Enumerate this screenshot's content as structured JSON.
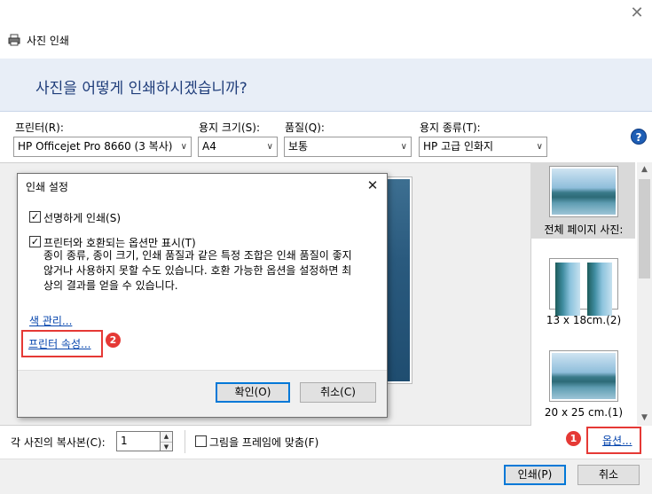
{
  "window": {
    "title": "사진 인쇄",
    "close_glyph": "✕"
  },
  "banner": {
    "heading": "사진을 어떻게 인쇄하시겠습니까?"
  },
  "selectors": {
    "printer": {
      "label": "프린터(R):",
      "value": "HP Officejet Pro 8660 (3 복사)"
    },
    "paper_size": {
      "label": "용지 크기(S):",
      "value": "A4"
    },
    "quality": {
      "label": "품질(Q):",
      "value": "보통"
    },
    "paper_type": {
      "label": "용지 종류(T):",
      "value": "HP 고급 인화지"
    }
  },
  "help_glyph": "?",
  "layouts": [
    {
      "label": "전체 페이지 사진:",
      "selected": true
    },
    {
      "label": "13 x 18cm.(2)",
      "selected": false
    },
    {
      "label": "20 x 25 cm.(1)",
      "selected": false
    }
  ],
  "dialog": {
    "title": "인쇄 설정",
    "close_glyph": "✕",
    "sharpen": {
      "label": "선명하게 인쇄(S)",
      "checked": true
    },
    "compatible": {
      "label": "프린터와 호환되는 옵션만 표시(T)",
      "checked": true,
      "description_lines": [
        "종이 종류, 종이 크기, 인쇄 품질과 같은 특정 조합은 인쇄 품질이 좋지",
        "않거나 사용하지 못할 수도 있습니다. 호환 가능한 옵션을 설정하면 최",
        "상의 결과를 얻을 수 있습니다."
      ]
    },
    "color_management_link": "색 관리...",
    "printer_properties_link": "프린터 속성...",
    "ok_button": "확인(O)",
    "cancel_button": "취소(C)"
  },
  "copies": {
    "label": "각 사진의 복사본(C):",
    "value": "1",
    "up_glyph": "▲",
    "down_glyph": "▼"
  },
  "fit_to_frame": {
    "label": "그림을 프레임에 맞춤(F)",
    "checked": false
  },
  "options_link": "옵션...",
  "annotations": {
    "badge_1": "1",
    "badge_2": "2",
    "highlight_color": "#e53935"
  },
  "footer": {
    "print_button": "인쇄(P)",
    "cancel_button": "취소"
  },
  "scroll": {
    "up_glyph": "▲",
    "down_glyph": "▼"
  }
}
